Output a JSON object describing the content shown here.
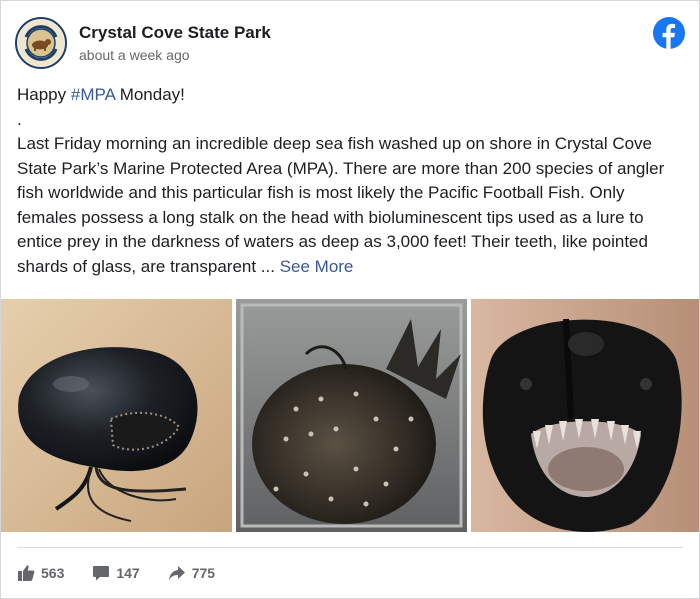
{
  "post": {
    "page_name": "Crystal Cove State Park",
    "time": "about a week ago",
    "avatar_text": {
      "top": "CALIFORNIA",
      "bottom": "STATE PARKS"
    },
    "line1_prefix": "Happy ",
    "hashtag": "#MPA",
    "line1_suffix": " Monday!",
    "dot": ".",
    "body": "Last Friday morning an incredible deep sea fish washed up on shore in Crystal Cove State Park’s Marine Protected Area (MPA). There are more than 200 species of angler fish worldwide and this particular fish is most likely the Pacific Football Fish. Only females possess a long stalk on the head with bioluminescent tips used as a lure to entice prey in the darkness of waters as deep as 3,000 feet! Their teeth, like pointed shards of glass, are transparent ... ",
    "see_more": "See More"
  },
  "stats": {
    "likes": "563",
    "comments": "147",
    "shares": "775"
  },
  "colors": {
    "link": "#385898",
    "facebook_blue": "#1877f2",
    "muted": "#65676b"
  },
  "icons": {
    "brand": "facebook-logo-icon",
    "like": "thumbs-up-icon",
    "comment": "comment-bubble-icon",
    "share": "share-arrow-icon"
  }
}
